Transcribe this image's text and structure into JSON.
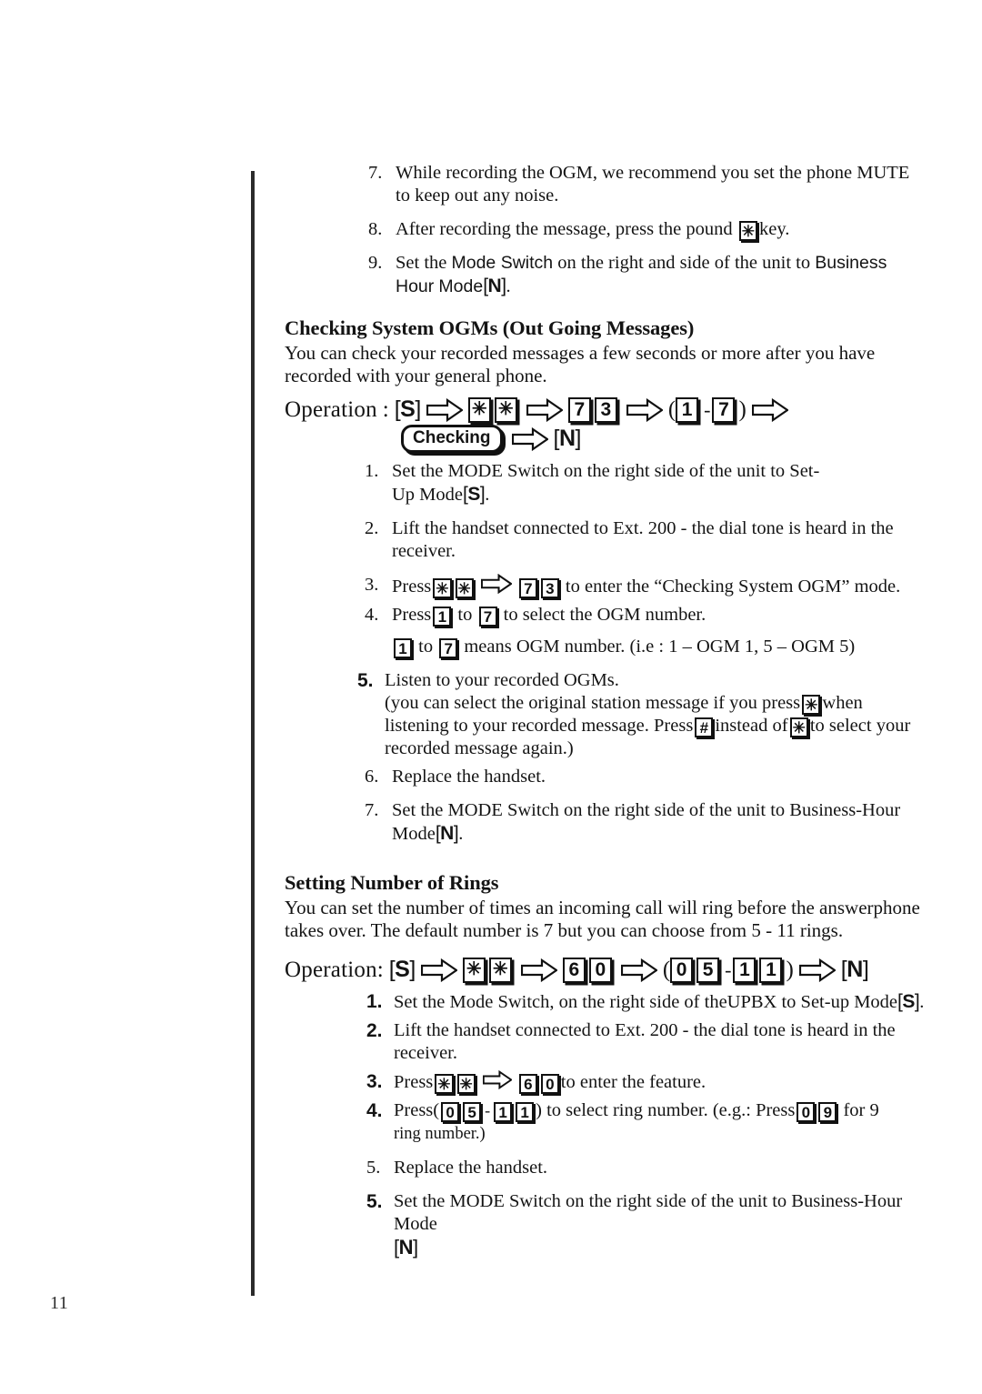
{
  "page": {
    "number": "11"
  },
  "continued_steps": [
    {
      "num": "7.",
      "text": "While recording the OGM, we recommend you set the phone MUTE to keep out any noise."
    },
    {
      "num": "8.",
      "pre": "After recording the message, press the pound",
      "key": "✳",
      "post": "key."
    },
    {
      "num": "9.",
      "pre": "Set the",
      "em1": "Mode Switch",
      "mid": "on the right and side of the unit to",
      "em2": "Business Hour",
      "mid2": "Mode",
      "mode": "N",
      "post": "."
    }
  ],
  "section_ogm": {
    "heading": "Checking System OGMs (Out Going Messages)",
    "intro": "You can check your recorded messages a few seconds or more after you have recorded with your general phone.",
    "operation": {
      "label": "Operation",
      "colon": ":",
      "mode_start": "S",
      "star1": "✳",
      "star2": "✳",
      "code1": "7",
      "code2": "3",
      "range_open": "(",
      "range_from": "1",
      "range_dash": "-",
      "range_to": "7",
      "range_close": ")",
      "pill": "Checking",
      "mode_end": "N"
    },
    "steps": [
      {
        "num": "1.",
        "line1": "Set the MODE Switch on the right side of the unit to Set-",
        "line2_pre": "Up Mode",
        "line2_mode": "S",
        "line2_post": "."
      },
      {
        "num": "2.",
        "text": "Lift the handset connected to Ext. 200 - the dial tone is heard in the receiver."
      },
      {
        "num": "3.",
        "pre": "Press",
        "star1": "✳",
        "star2": "✳",
        "code1": "7",
        "code2": "3",
        "post": "to enter the “Checking System OGM” mode."
      },
      {
        "num": "4.",
        "pre": "Press",
        "key1": "1",
        "mid": "to",
        "key2": "7",
        "post": "to select the OGM number."
      }
    ],
    "note": {
      "key1": "1",
      "mid": "to",
      "key2": "7",
      "post": "means OGM number.  (i.e : 1 – OGM 1,  5 – OGM 5)"
    },
    "steps2": [
      {
        "num": "5.",
        "line1": "Listen to your recorded OGMs.",
        "sub1_pre": "(you can select the original station message if you press",
        "sub1_key": "✳",
        "sub1_post": "when",
        "sub2_pre": "listening to your recorded message. Press",
        "sub2_key1": "#",
        "sub2_mid": "instead of",
        "sub2_key2": "✳",
        "sub2_post": "to select your",
        "sub3": "recorded message again.)"
      },
      {
        "num": "6.",
        "text": "Replace the handset."
      },
      {
        "num": "7.",
        "line1": "Set the MODE Switch on the right side of the unit to Business-Hour",
        "line2_pre": "Mode",
        "line2_mode": "N",
        "line2_post": "."
      }
    ]
  },
  "section_rings": {
    "heading": "Setting Number of Rings",
    "intro": "You can set the number of times an incoming call will ring before the answerphone takes over. The default number is 7 but you can choose from 5 - 11 rings.",
    "operation": {
      "label": "Operation",
      "colon": ":",
      "mode_start": "S",
      "star1": "✳",
      "star2": "✳",
      "code1": "6",
      "code2": "0",
      "range_open": "(",
      "range_from1": "0",
      "range_from2": "5",
      "range_dash": "-",
      "range_to1": "1",
      "range_to2": "1",
      "range_close": ")",
      "mode_end": "N"
    },
    "steps": [
      {
        "num": "1.",
        "pre": "Set the Mode Switch, on the right side of theUPBX to Set-up Mode",
        "mode": "S",
        "post": "."
      },
      {
        "num": "2.",
        "text": "Lift the handset connected to Ext. 200 -  the dial tone is heard in the receiver."
      },
      {
        "num": "3.",
        "pre": "Press",
        "star1": "✳",
        "star2": "✳",
        "code1": "6",
        "code2": "0",
        "post": "to enter the feature."
      },
      {
        "num": "4.",
        "pre": "Press",
        "open": "(",
        "k1": "0",
        "k2": "5",
        "dash": "-",
        "k3": "1",
        "k4": "1",
        "close": ")",
        "mid": "to select ring number.  (e.g.: Press",
        "k5": "0",
        "k6": "9",
        "post": "for 9",
        "line2": "ring number.)"
      },
      {
        "num": "5.",
        "text": "Replace the handset."
      },
      {
        "num": "5.",
        "line1": "Set the MODE Switch on the right side of the unit to Business-Hour Mode",
        "line2_mode": "N"
      }
    ]
  },
  "icons": {
    "arrow": "right-arrow-outline-icon",
    "star_key": "star-key-icon",
    "hash_key": "hash-key-icon"
  }
}
